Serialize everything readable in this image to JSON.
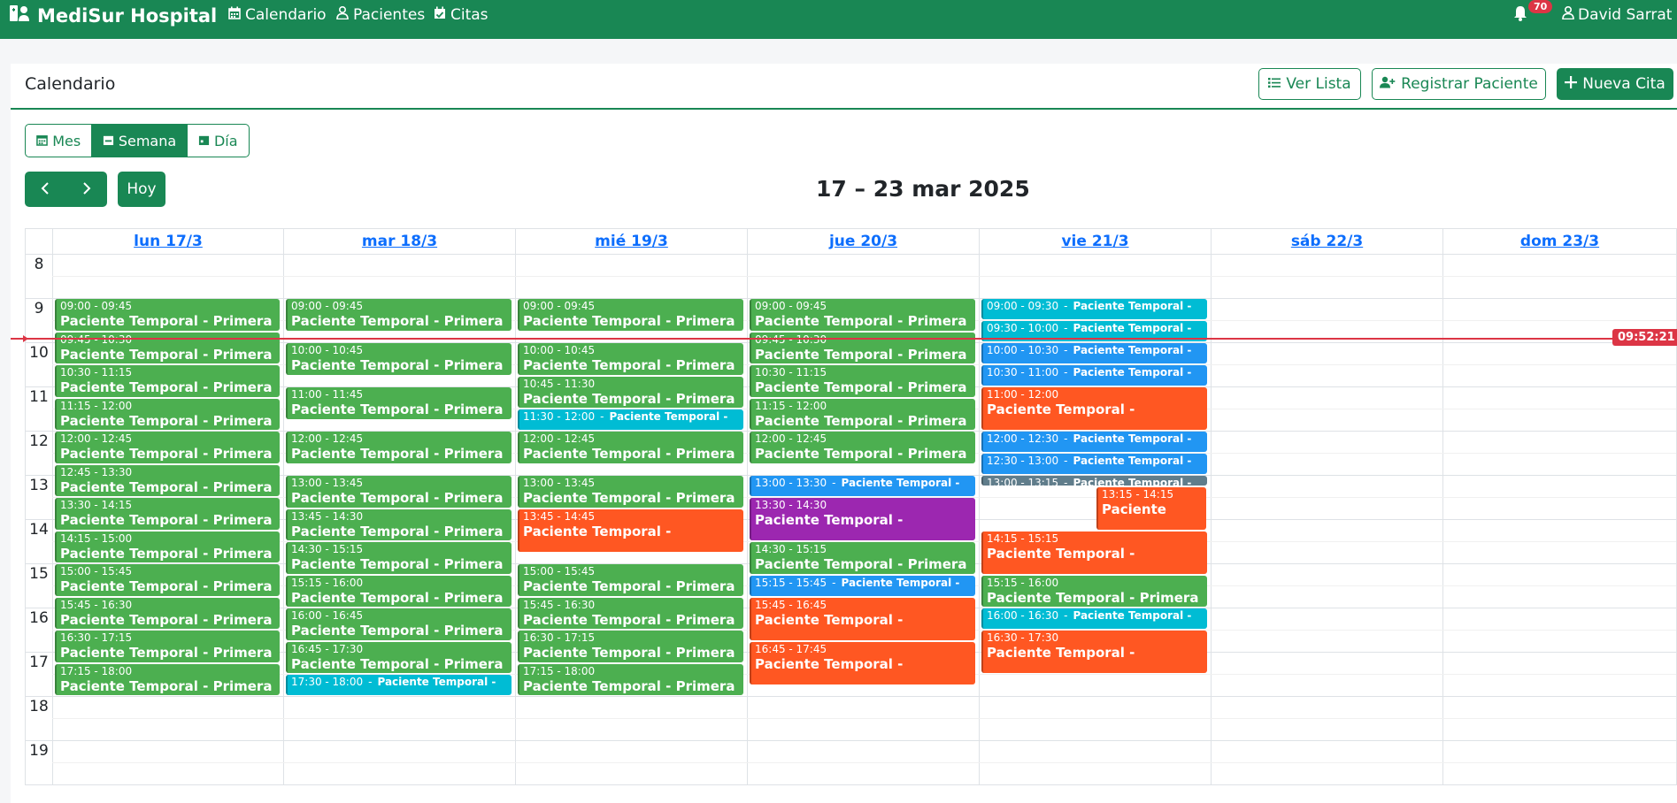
{
  "navbar": {
    "brand": "MediSur Hospital",
    "links": [
      "Calendario",
      "Pacientes",
      "Citas"
    ],
    "notifications": "70",
    "user": "David Sarrat"
  },
  "page": {
    "title": "Calendario",
    "ver_lista": "Ver Lista",
    "registrar": "Registrar Paciente",
    "nueva_cita": "Nueva Cita"
  },
  "view": {
    "mes": "Mes",
    "semana": "Semana",
    "dia": "Día",
    "active": "semana"
  },
  "nav": {
    "hoy": "Hoy"
  },
  "range_title": "17 – 23 mar 2025",
  "days": [
    "lun 17/3",
    "mar 18/3",
    "mié 19/3",
    "jue 20/3",
    "vie 21/3",
    "sáb 22/3",
    "dom 23/3"
  ],
  "hours": [
    "8",
    "9",
    "10",
    "11",
    "12",
    "13",
    "14",
    "15",
    "16",
    "17",
    "18",
    "19"
  ],
  "now_time": "09:52:21",
  "colors": {
    "primary": "#198754",
    "green": "#4caf50",
    "cyan": "#00bcd4",
    "blue": "#2196f3",
    "orange": "#ff5722",
    "purple": "#9c27b0",
    "gray": "#607d8b",
    "now": "#dc3545"
  },
  "events": [
    {
      "day": 0,
      "start": "09:00",
      "end": "09:45",
      "time": "09:00 - 09:45",
      "name": "Paciente Temporal - Primera",
      "color": "green"
    },
    {
      "day": 0,
      "start": "09:45",
      "end": "10:30",
      "time": "09:45 - 10:30",
      "name": "Paciente Temporal - Primera",
      "color": "green"
    },
    {
      "day": 0,
      "start": "10:30",
      "end": "11:15",
      "time": "10:30 - 11:15",
      "name": "Paciente Temporal - Primera",
      "color": "green"
    },
    {
      "day": 0,
      "start": "11:15",
      "end": "12:00",
      "time": "11:15 - 12:00",
      "name": "Paciente Temporal - Primera",
      "color": "green"
    },
    {
      "day": 0,
      "start": "12:00",
      "end": "12:45",
      "time": "12:00 - 12:45",
      "name": "Paciente Temporal - Primera",
      "color": "green"
    },
    {
      "day": 0,
      "start": "12:45",
      "end": "13:30",
      "time": "12:45 - 13:30",
      "name": "Paciente Temporal - Primera",
      "color": "green"
    },
    {
      "day": 0,
      "start": "13:30",
      "end": "14:15",
      "time": "13:30 - 14:15",
      "name": "Paciente Temporal - Primera",
      "color": "green"
    },
    {
      "day": 0,
      "start": "14:15",
      "end": "15:00",
      "time": "14:15 - 15:00",
      "name": "Paciente Temporal - Primera",
      "color": "green"
    },
    {
      "day": 0,
      "start": "15:00",
      "end": "15:45",
      "time": "15:00 - 15:45",
      "name": "Paciente Temporal - Primera",
      "color": "green"
    },
    {
      "day": 0,
      "start": "15:45",
      "end": "16:30",
      "time": "15:45 - 16:30",
      "name": "Paciente Temporal - Primera",
      "color": "green"
    },
    {
      "day": 0,
      "start": "16:30",
      "end": "17:15",
      "time": "16:30 - 17:15",
      "name": "Paciente Temporal - Primera",
      "color": "green"
    },
    {
      "day": 0,
      "start": "17:15",
      "end": "18:00",
      "time": "17:15 - 18:00",
      "name": "Paciente Temporal - Primera",
      "color": "green"
    },
    {
      "day": 1,
      "start": "09:00",
      "end": "09:45",
      "time": "09:00 - 09:45",
      "name": "Paciente Temporal - Primera",
      "color": "green"
    },
    {
      "day": 1,
      "start": "10:00",
      "end": "10:45",
      "time": "10:00 - 10:45",
      "name": "Paciente Temporal - Primera",
      "color": "green"
    },
    {
      "day": 1,
      "start": "11:00",
      "end": "11:45",
      "time": "11:00 - 11:45",
      "name": "Paciente Temporal - Primera",
      "color": "green"
    },
    {
      "day": 1,
      "start": "12:00",
      "end": "12:45",
      "time": "12:00 - 12:45",
      "name": "Paciente Temporal - Primera",
      "color": "green"
    },
    {
      "day": 1,
      "start": "13:00",
      "end": "13:45",
      "time": "13:00 - 13:45",
      "name": "Paciente Temporal - Primera",
      "color": "green"
    },
    {
      "day": 1,
      "start": "13:45",
      "end": "14:30",
      "time": "13:45 - 14:30",
      "name": "Paciente Temporal - Primera",
      "color": "green"
    },
    {
      "day": 1,
      "start": "14:30",
      "end": "15:15",
      "time": "14:30 - 15:15",
      "name": "Paciente Temporal - Primera",
      "color": "green"
    },
    {
      "day": 1,
      "start": "15:15",
      "end": "16:00",
      "time": "15:15 - 16:00",
      "name": "Paciente Temporal - Primera",
      "color": "green"
    },
    {
      "day": 1,
      "start": "16:00",
      "end": "16:45",
      "time": "16:00 - 16:45",
      "name": "Paciente Temporal - Primera",
      "color": "green"
    },
    {
      "day": 1,
      "start": "16:45",
      "end": "17:30",
      "time": "16:45 - 17:30",
      "name": "Paciente Temporal - Primera",
      "color": "green"
    },
    {
      "day": 1,
      "start": "17:30",
      "end": "18:00",
      "time": "17:30 - 18:00",
      "name": "Paciente Temporal -",
      "color": "cyan",
      "inline": true
    },
    {
      "day": 2,
      "start": "09:00",
      "end": "09:45",
      "time": "09:00 - 09:45",
      "name": "Paciente Temporal - Primera",
      "color": "green"
    },
    {
      "day": 2,
      "start": "10:00",
      "end": "10:45",
      "time": "10:00 - 10:45",
      "name": "Paciente Temporal - Primera",
      "color": "green"
    },
    {
      "day": 2,
      "start": "10:45",
      "end": "11:30",
      "time": "10:45 - 11:30",
      "name": "Paciente Temporal - Primera",
      "color": "green"
    },
    {
      "day": 2,
      "start": "11:30",
      "end": "12:00",
      "time": "11:30 - 12:00",
      "name": "Paciente Temporal -",
      "color": "cyan",
      "inline": true
    },
    {
      "day": 2,
      "start": "12:00",
      "end": "12:45",
      "time": "12:00 - 12:45",
      "name": "Paciente Temporal - Primera",
      "color": "green"
    },
    {
      "day": 2,
      "start": "13:00",
      "end": "13:45",
      "time": "13:00 - 13:45",
      "name": "Paciente Temporal - Primera",
      "color": "green"
    },
    {
      "day": 2,
      "start": "13:45",
      "end": "14:45",
      "time": "13:45 - 14:45",
      "name": "Paciente Temporal -",
      "color": "orange"
    },
    {
      "day": 2,
      "start": "15:00",
      "end": "15:45",
      "time": "15:00 - 15:45",
      "name": "Paciente Temporal - Primera",
      "color": "green"
    },
    {
      "day": 2,
      "start": "15:45",
      "end": "16:30",
      "time": "15:45 - 16:30",
      "name": "Paciente Temporal - Primera",
      "color": "green"
    },
    {
      "day": 2,
      "start": "16:30",
      "end": "17:15",
      "time": "16:30 - 17:15",
      "name": "Paciente Temporal - Primera",
      "color": "green"
    },
    {
      "day": 2,
      "start": "17:15",
      "end": "18:00",
      "time": "17:15 - 18:00",
      "name": "Paciente Temporal - Primera",
      "color": "green"
    },
    {
      "day": 3,
      "start": "09:00",
      "end": "09:45",
      "time": "09:00 - 09:45",
      "name": "Paciente Temporal - Primera",
      "color": "green"
    },
    {
      "day": 3,
      "start": "09:45",
      "end": "10:30",
      "time": "09:45 - 10:30",
      "name": "Paciente Temporal - Primera",
      "color": "green"
    },
    {
      "day": 3,
      "start": "10:30",
      "end": "11:15",
      "time": "10:30 - 11:15",
      "name": "Paciente Temporal - Primera",
      "color": "green"
    },
    {
      "day": 3,
      "start": "11:15",
      "end": "12:00",
      "time": "11:15 - 12:00",
      "name": "Paciente Temporal - Primera",
      "color": "green"
    },
    {
      "day": 3,
      "start": "12:00",
      "end": "12:45",
      "time": "12:00 - 12:45",
      "name": "Paciente Temporal - Primera",
      "color": "green"
    },
    {
      "day": 3,
      "start": "13:00",
      "end": "13:30",
      "time": "13:00 - 13:30",
      "name": "Paciente Temporal -",
      "color": "blue",
      "inline": true
    },
    {
      "day": 3,
      "start": "13:30",
      "end": "14:30",
      "time": "13:30 - 14:30",
      "name": "Paciente Temporal -",
      "color": "purple"
    },
    {
      "day": 3,
      "start": "14:30",
      "end": "15:15",
      "time": "14:30 - 15:15",
      "name": "Paciente Temporal - Primera",
      "color": "green"
    },
    {
      "day": 3,
      "start": "15:15",
      "end": "15:45",
      "time": "15:15 - 15:45",
      "name": "Paciente Temporal -",
      "color": "blue",
      "inline": true
    },
    {
      "day": 3,
      "start": "15:45",
      "end": "16:45",
      "time": "15:45 - 16:45",
      "name": "Paciente Temporal -",
      "color": "orange"
    },
    {
      "day": 3,
      "start": "16:45",
      "end": "17:45",
      "time": "16:45 - 17:45",
      "name": "Paciente Temporal -",
      "color": "orange"
    },
    {
      "day": 4,
      "start": "09:00",
      "end": "09:30",
      "time": "09:00 - 09:30",
      "name": "Paciente Temporal -",
      "color": "cyan",
      "inline": true
    },
    {
      "day": 4,
      "start": "09:30",
      "end": "10:00",
      "time": "09:30 - 10:00",
      "name": "Paciente Temporal -",
      "color": "cyan",
      "inline": true
    },
    {
      "day": 4,
      "start": "10:00",
      "end": "10:30",
      "time": "10:00 - 10:30",
      "name": "Paciente Temporal -",
      "color": "blue",
      "inline": true
    },
    {
      "day": 4,
      "start": "10:30",
      "end": "11:00",
      "time": "10:30 - 11:00",
      "name": "Paciente Temporal -",
      "color": "blue",
      "inline": true
    },
    {
      "day": 4,
      "start": "11:00",
      "end": "12:00",
      "time": "11:00 - 12:00",
      "name": "Paciente Temporal -",
      "color": "orange"
    },
    {
      "day": 4,
      "start": "12:00",
      "end": "12:30",
      "time": "12:00 - 12:30",
      "name": "Paciente Temporal -",
      "color": "blue",
      "inline": true
    },
    {
      "day": 4,
      "start": "12:30",
      "end": "13:00",
      "time": "12:30 - 13:00",
      "name": "Paciente Temporal -",
      "color": "blue",
      "inline": true
    },
    {
      "day": 4,
      "start": "13:00",
      "end": "13:15",
      "time": "13:00 - 13:15",
      "name": "Paciente Temporal -",
      "color": "gray",
      "inline": true
    },
    {
      "day": 4,
      "start": "13:15",
      "end": "14:15",
      "time": "13:15 - 14:15",
      "name": "Paciente",
      "color": "orange",
      "half": true
    },
    {
      "day": 4,
      "start": "14:15",
      "end": "15:15",
      "time": "14:15 - 15:15",
      "name": "Paciente Temporal -",
      "color": "orange"
    },
    {
      "day": 4,
      "start": "15:15",
      "end": "16:00",
      "time": "15:15 - 16:00",
      "name": "Paciente Temporal - Primera",
      "color": "green"
    },
    {
      "day": 4,
      "start": "16:00",
      "end": "16:30",
      "time": "16:00 - 16:30",
      "name": "Paciente Temporal -",
      "color": "cyan",
      "inline": true
    },
    {
      "day": 4,
      "start": "16:30",
      "end": "17:30",
      "time": "16:30 - 17:30",
      "name": "Paciente Temporal -",
      "color": "orange"
    }
  ]
}
